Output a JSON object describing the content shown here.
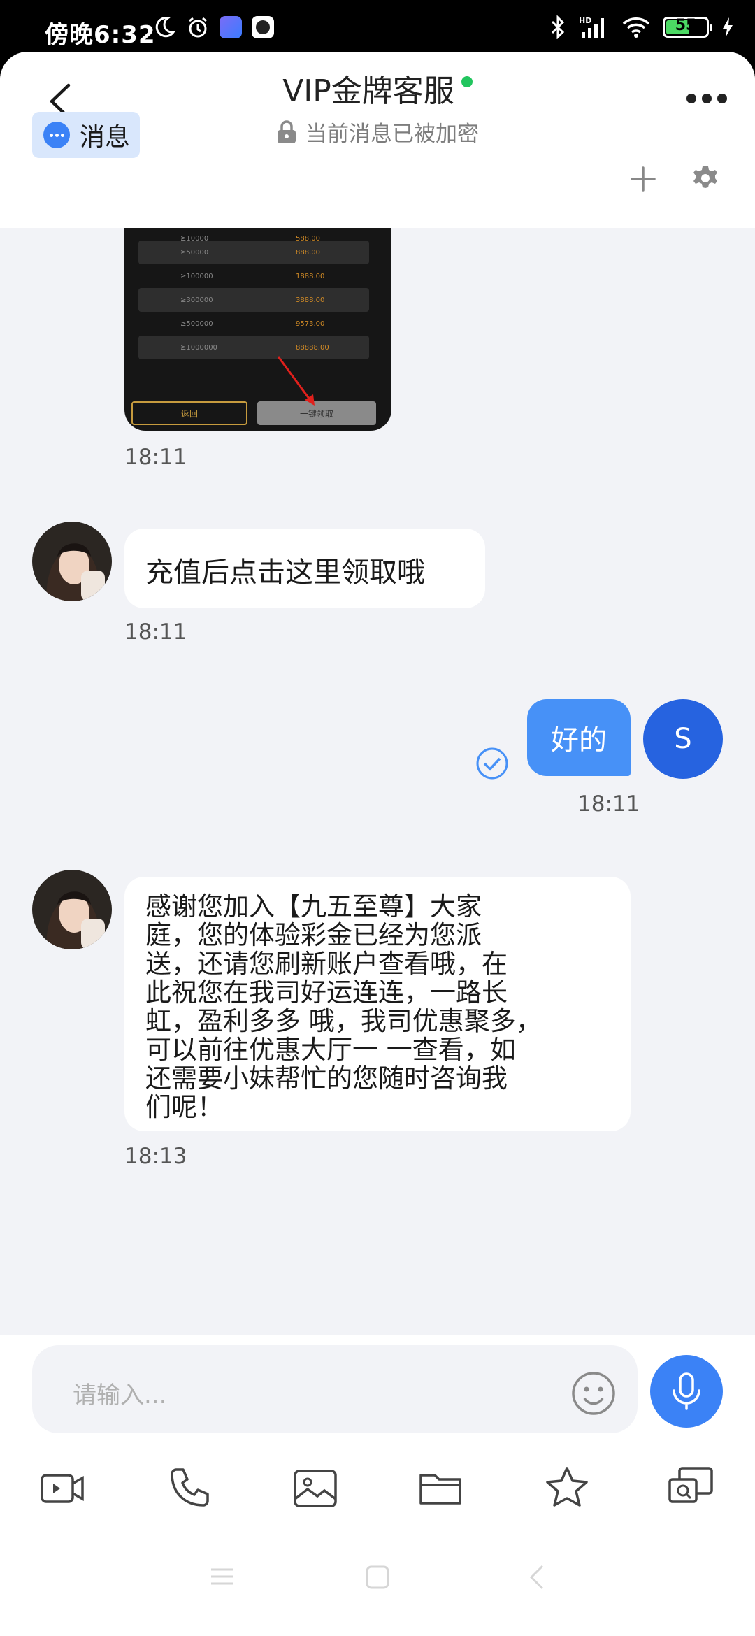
{
  "status_bar": {
    "time": "傍晚6:32",
    "battery": "55",
    "network": "HD"
  },
  "header": {
    "title": "VIP金牌客服",
    "subtitle": "当前消息已被加密"
  },
  "tab": {
    "label": "消息"
  },
  "screenshot_image": {
    "rows": [
      {
        "threshold": "≥10000",
        "amount": "588.00"
      },
      {
        "threshold": "≥50000",
        "amount": "888.00"
      },
      {
        "threshold": "≥100000",
        "amount": "1888.00"
      },
      {
        "threshold": "≥300000",
        "amount": "3888.00"
      },
      {
        "threshold": "≥500000",
        "amount": "9573.00"
      },
      {
        "threshold": "≥1000000",
        "amount": "88888.00"
      }
    ],
    "return_button": "返回",
    "claim_button": "一键领取"
  },
  "messages": [
    {
      "sender": "agent",
      "type": "image",
      "time": "18:11"
    },
    {
      "sender": "agent",
      "type": "text",
      "text": "充值后点击这里领取哦",
      "time": "18:11"
    },
    {
      "sender": "self",
      "type": "text",
      "text": "好的",
      "time": "18:11",
      "avatar_letter": "S",
      "read": true
    },
    {
      "sender": "agent",
      "type": "text",
      "lines": [
        "感谢您加入【九五至尊】大家",
        "庭，您的体验彩金已经为您派",
        "送，还请您刷新账户查看哦，在",
        "此祝您在我司好运连连，一路长",
        "虹，盈利多多 哦，我司优惠聚多，",
        "可以前往优惠大厅一 一查看，如",
        "还需要小妹帮忙的您随时咨询我",
        "们呢！"
      ],
      "time": "18:13"
    }
  ],
  "input": {
    "placeholder": "请输入..."
  },
  "toolbar_icons": [
    "video-icon",
    "phone-icon",
    "image-icon",
    "folder-icon",
    "star-icon",
    "screen-share-icon"
  ],
  "colors": {
    "accent": "#3b82f6",
    "outgoing_bubble": "#4791f7",
    "chat_bg": "#f2f3f7",
    "online": "#22c55e"
  }
}
